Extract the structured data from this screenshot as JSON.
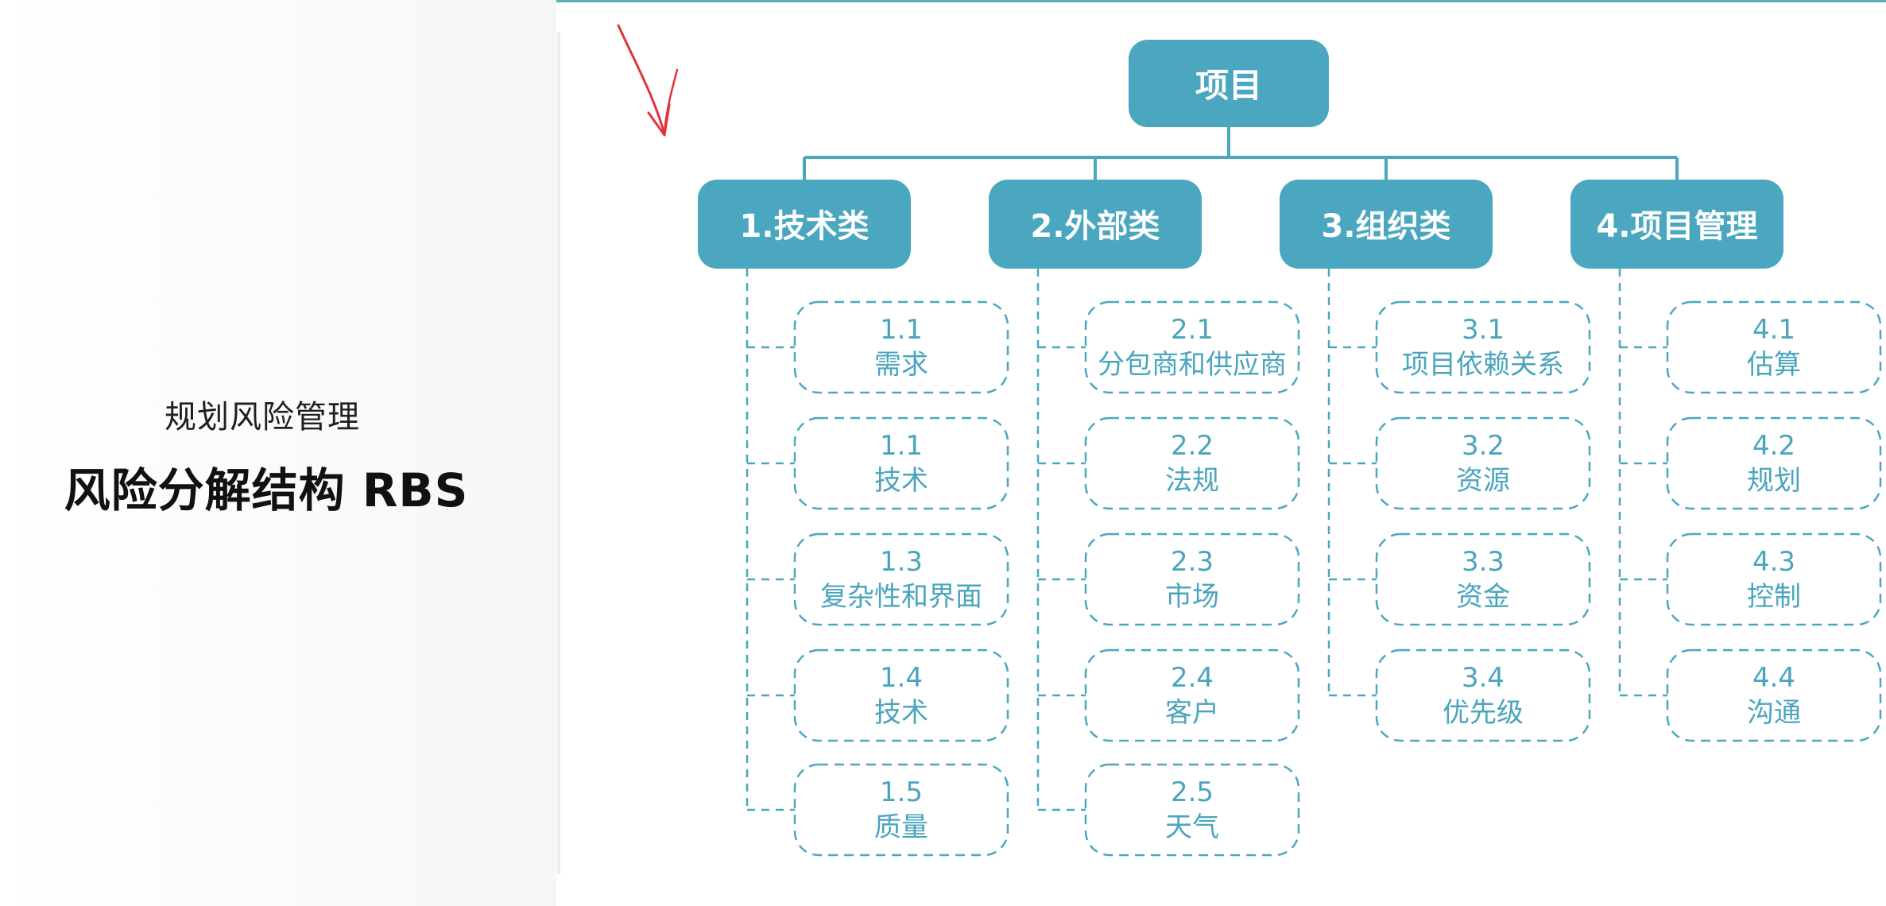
{
  "slide": {
    "subtitle": "规划风险管理",
    "title": "风险分解结构 RBS"
  },
  "colors": {
    "accent": "#4aa7bf",
    "item_text": "#4aa5bd",
    "annotation": "#e0343c"
  },
  "tree": {
    "root": "项目",
    "categories": [
      {
        "label": "1.技术类",
        "items": [
          {
            "code": "1.1",
            "name": "需求"
          },
          {
            "code": "1.1",
            "name": "技术"
          },
          {
            "code": "1.3",
            "name": "复杂性和界面"
          },
          {
            "code": "1.4",
            "name": "技术"
          },
          {
            "code": "1.5",
            "name": "质量"
          }
        ]
      },
      {
        "label": "2.外部类",
        "items": [
          {
            "code": "2.1",
            "name": "分包商和供应商"
          },
          {
            "code": "2.2",
            "name": "法规"
          },
          {
            "code": "2.3",
            "name": "市场"
          },
          {
            "code": "2.4",
            "name": "客户"
          },
          {
            "code": "2.5",
            "name": "天气"
          }
        ]
      },
      {
        "label": "3.组织类",
        "items": [
          {
            "code": "3.1",
            "name": "项目依赖关系"
          },
          {
            "code": "3.2",
            "name": "资源"
          },
          {
            "code": "3.3",
            "name": "资金"
          },
          {
            "code": "3.4",
            "name": "优先级"
          }
        ]
      },
      {
        "label": "4.项目管理",
        "items": [
          {
            "code": "4.1",
            "name": "估算"
          },
          {
            "code": "4.2",
            "name": "规划"
          },
          {
            "code": "4.3",
            "name": "控制"
          },
          {
            "code": "4.4",
            "name": "沟通"
          }
        ]
      }
    ]
  }
}
